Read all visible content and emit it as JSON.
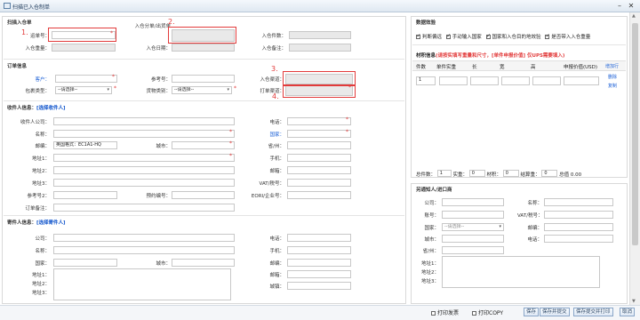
{
  "window": {
    "title": "扫描已入仓制单",
    "minimize": "–",
    "close": "✕"
  },
  "scan_section": {
    "title": "扫描入仓单",
    "order_no_label": "运单号：",
    "inbound_no_label": "入仓分单/出货单",
    "inbound_count_label": "入仓件数：",
    "inbound_weight_label": "入仓重量：",
    "inbound_date_label": "入仓日期：",
    "inbound_remark_label": "入仓备注："
  },
  "order_info": {
    "title": "订单信息",
    "customer_label": "客户：",
    "ref_no_label": "参考号：",
    "inbound_channel_label": "入仓渠道：",
    "package_type_label": "包裹类型：",
    "package_type_value": "--请选择--",
    "goods_type_label": "货物类别：",
    "goods_type_value": "--请选择--",
    "print_channel_label": "打单渠道："
  },
  "receiver": {
    "title": "收件人信息：",
    "select_link": "[选择收件人]",
    "company_label": "收件人公司：",
    "phone_label": "电话：",
    "name_label": "名称：",
    "country_label": "国家：",
    "postcode_label": "邮编：",
    "postcode_value": "英国格式：EC1A1-HQ",
    "city_label": "城市：",
    "province_label": "省/州：",
    "address1_label": "地址1：",
    "mobile_label": "手机：",
    "address2_label": "地址2：",
    "email_label": "邮箱：",
    "address3_label": "地址3：",
    "vat_label": "VAT/税号：",
    "ref2_label": "参考号2：",
    "booking_label": "预约编号：",
    "eori_label": "EORI/企业号：",
    "order_remark_label": "订单备注："
  },
  "sender": {
    "title": "寄件人信息：",
    "select_link": "[选择寄件人]",
    "company_label": "公司：",
    "phone_label": "电话：",
    "name_label": "名称：",
    "mobile_label": "手机：",
    "country_label": "国家：",
    "city_label": "城市：",
    "postcode_label": "邮编：",
    "address1_label": "地址1：",
    "email_label": "邮箱：",
    "address2_label": "地址2：",
    "address3_label": "地址3：",
    "town_label": "城镇："
  },
  "data_check": {
    "title": "数据效验",
    "options": [
      {
        "label": "判断偏远",
        "checked": true
      },
      {
        "label": "手动输入国家",
        "checked": true
      },
      {
        "label": "国家和入仓目的地效验",
        "checked": true
      },
      {
        "label": "是否带入入仓重量",
        "checked": true
      }
    ]
  },
  "material": {
    "title": "材积信息",
    "hint": "(请按实填写重量和尺寸，[单件申报价值] 仅UPS需要填入)",
    "columns": [
      "件数",
      "单件实重",
      "长",
      "宽",
      "高",
      "申报价值(USD)"
    ],
    "row": {
      "count": "1"
    },
    "add_row": "增加行",
    "delete": "删除",
    "copy": "复制",
    "total_count_label": "总件数：",
    "total_count_value": "1",
    "actual_weight_label": "实重：",
    "actual_weight_value": "0",
    "volume_label": "材积：",
    "volume_value": "0",
    "total_weight_label": "结算重：",
    "total_weight_value": "0",
    "total_value_label": "总值",
    "total_value_value": "0.00"
  },
  "notify": {
    "title": "另通知人/进口商",
    "company_label": "公司：",
    "name_label": "名称：",
    "account_label": "账号：",
    "vat_label": "VAT/税号：",
    "country_label": "国家：",
    "country_value": "--请选择--",
    "postcode_label": "邮编：",
    "city_label": "城市：",
    "phone_label": "电话：",
    "province_label": "省/州：",
    "address1_label": "地址1：",
    "address2_label": "地址2：",
    "address3_label": "地址3："
  },
  "annotations": [
    "1.",
    "2.",
    "3.",
    "4."
  ],
  "footer": {
    "print_invoice": "打印发票",
    "print_copy": "打印COPY",
    "save": "保存",
    "save_submit": "保存并提交",
    "save_submit_print": "保存提交并打印",
    "cancel": "取消"
  }
}
